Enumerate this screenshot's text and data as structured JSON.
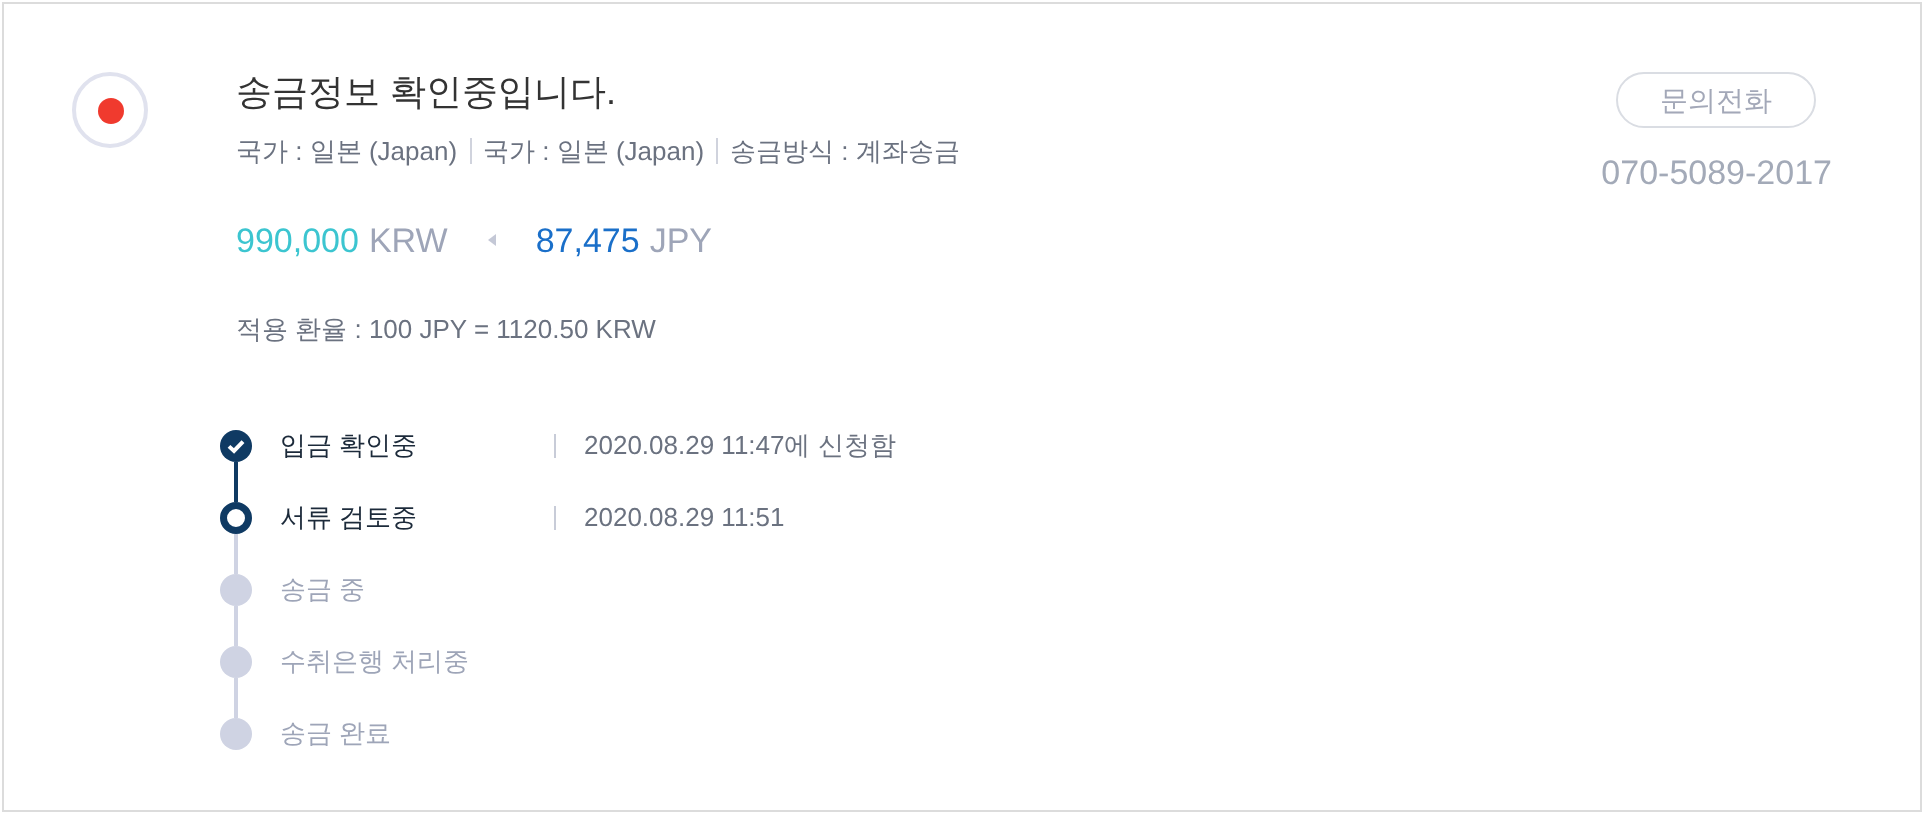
{
  "status": {
    "title": "송금정보 확인중입니다.",
    "meta": [
      "국가 : 일본 (Japan)",
      "국가 : 일본 (Japan)",
      "송금방식 : 계좌송금"
    ]
  },
  "amounts": {
    "send": {
      "value": "990,000",
      "currency": "KRW"
    },
    "receive": {
      "value": "87,475",
      "currency": "JPY"
    }
  },
  "rate": "적용 환율 : 100 JPY = 1120.50 KRW",
  "contact": {
    "button": "문의전화",
    "phone": "070-5089-2017"
  },
  "steps": [
    {
      "label": "입금 확인중",
      "kind": "done",
      "date": "2020.08.29 11:47에 신청함"
    },
    {
      "label": "서류 검토중",
      "kind": "current",
      "date": "2020.08.29 11:51"
    },
    {
      "label": "송금 중",
      "kind": "pending"
    },
    {
      "label": "수취은행 처리중",
      "kind": "pending"
    },
    {
      "label": "송금 완료",
      "kind": "pending"
    }
  ]
}
